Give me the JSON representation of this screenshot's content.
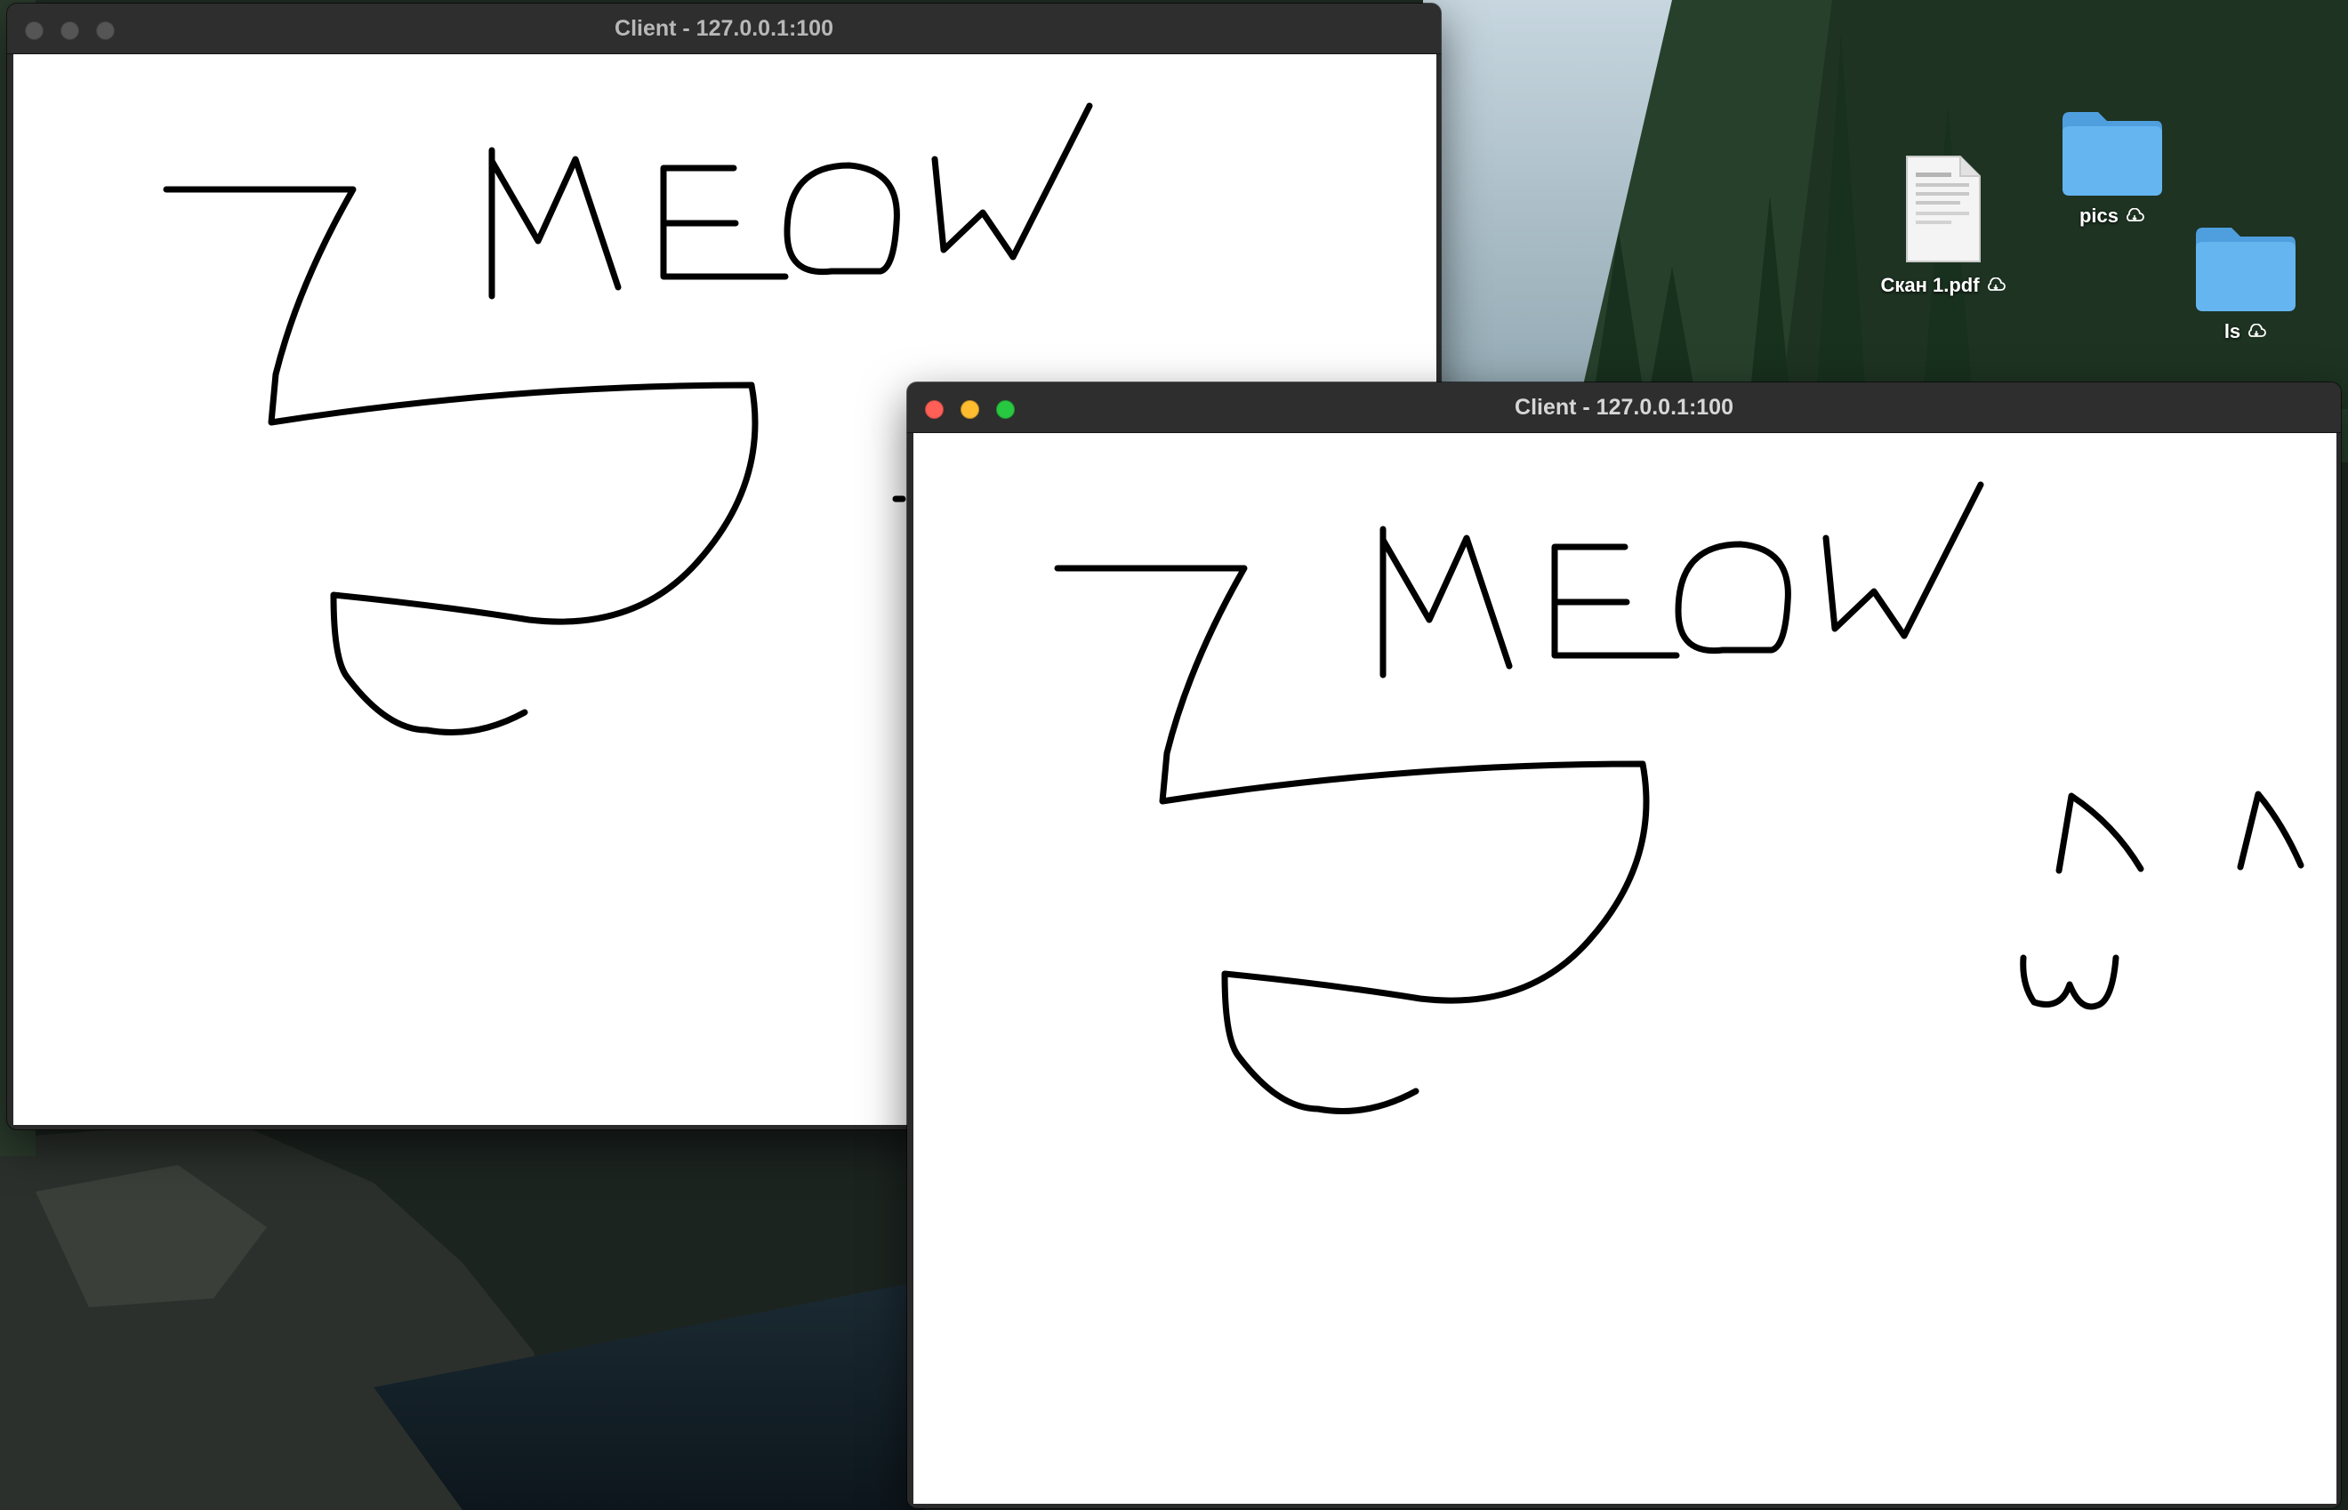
{
  "desktop": {
    "icons": [
      {
        "label": "Скан 1.pdf",
        "type": "pdf-document"
      },
      {
        "label": "pics",
        "type": "folder"
      },
      {
        "label": "ls",
        "type": "folder"
      }
    ]
  },
  "windows": [
    {
      "title": "Client - 127.0.0.1:100",
      "state": "inactive"
    },
    {
      "title": "Client - 127.0.0.1:100",
      "state": "active"
    }
  ],
  "drawing": {
    "text": "MEOW"
  },
  "colors": {
    "folder": "#5aabe8",
    "traffic_close": "#fe5f57",
    "traffic_minimize": "#febc2e",
    "traffic_maximize": "#28c840",
    "stroke": "#000000"
  }
}
